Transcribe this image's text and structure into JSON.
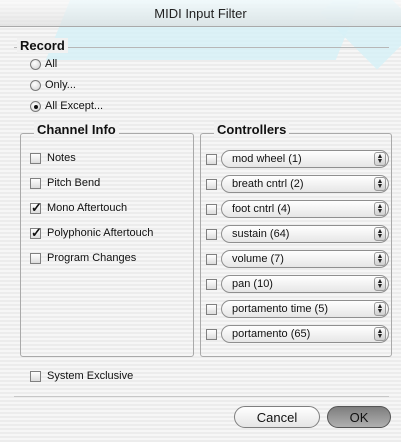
{
  "window": {
    "title": "MIDI Input Filter"
  },
  "record": {
    "label": "Record",
    "options": [
      {
        "label": "All",
        "checked": false
      },
      {
        "label": "Only...",
        "checked": false
      },
      {
        "label": "All Except...",
        "checked": true
      }
    ]
  },
  "channel_info": {
    "label": "Channel Info",
    "items": [
      {
        "label": "Notes",
        "checked": false
      },
      {
        "label": "Pitch Bend",
        "checked": false
      },
      {
        "label": "Mono Aftertouch",
        "checked": true
      },
      {
        "label": "Polyphonic Aftertouch",
        "checked": true
      },
      {
        "label": "Program Changes",
        "checked": false
      }
    ]
  },
  "controllers": {
    "label": "Controllers",
    "items": [
      {
        "label": "mod wheel (1)",
        "checked": false
      },
      {
        "label": "breath cntrl (2)",
        "checked": false
      },
      {
        "label": "foot cntrl (4)",
        "checked": false
      },
      {
        "label": "sustain (64)",
        "checked": false
      },
      {
        "label": "volume (7)",
        "checked": false
      },
      {
        "label": "pan (10)",
        "checked": false
      },
      {
        "label": "portamento time (5)",
        "checked": false
      },
      {
        "label": "portamento (65)",
        "checked": false
      }
    ]
  },
  "system_exclusive": {
    "label": "System Exclusive",
    "checked": false
  },
  "buttons": {
    "cancel": "Cancel",
    "ok": "OK"
  }
}
